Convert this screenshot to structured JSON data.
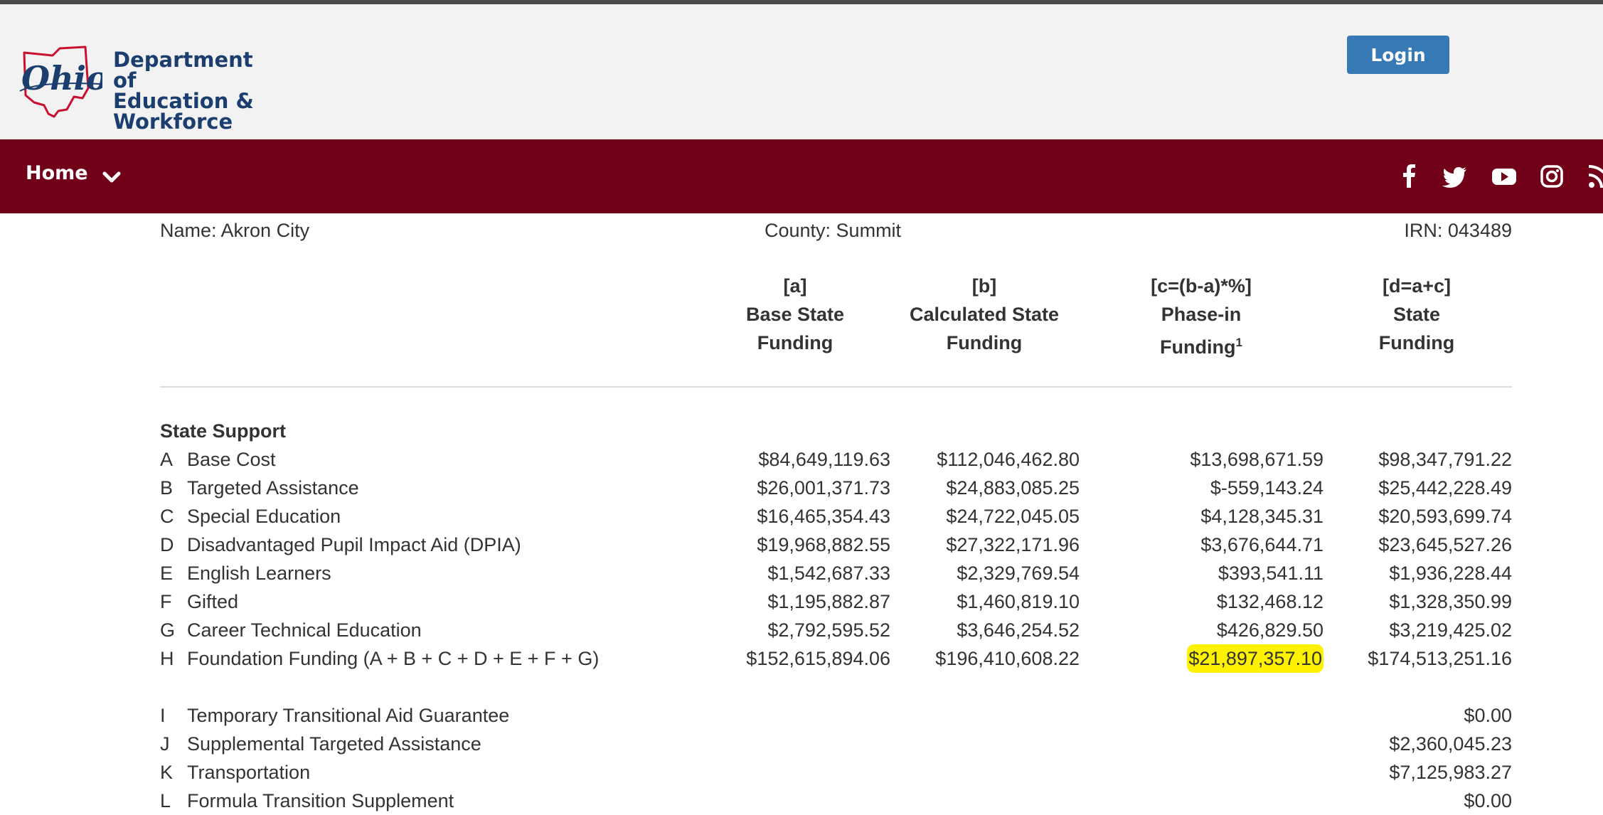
{
  "header": {
    "dept_line1": "Department of",
    "dept_line2": "Education &",
    "dept_line3": "Workforce",
    "login_label": "Login"
  },
  "nav": {
    "home_label": "Home",
    "social_icons": [
      "facebook-icon",
      "twitter-icon",
      "youtube-icon",
      "instagram-icon",
      "rss-icon"
    ]
  },
  "district": {
    "name": "Name: Akron City",
    "county": "County: Summit",
    "irn": "IRN: 043489"
  },
  "columns": [
    {
      "tag": "[a]",
      "line1": "Base State",
      "line2": "Funding",
      "sup": ""
    },
    {
      "tag": "[b]",
      "line1": "Calculated State",
      "line2": "Funding",
      "sup": ""
    },
    {
      "tag": "[c=(b-a)*%]",
      "line1": "Phase-in",
      "line2": "Funding",
      "sup": "1"
    },
    {
      "tag": "[d=a+c]",
      "line1": "State",
      "line2": "Funding",
      "sup": ""
    }
  ],
  "section_title": "State Support",
  "rows": [
    {
      "letter": "A",
      "label": "Base Cost",
      "a": "$84,649,119.63",
      "b": "$112,046,462.80",
      "c": "$13,698,671.59",
      "d": "$98,347,791.22"
    },
    {
      "letter": "B",
      "label": "Targeted Assistance",
      "a": "$26,001,371.73",
      "b": "$24,883,085.25",
      "c": "$-559,143.24",
      "d": "$25,442,228.49"
    },
    {
      "letter": "C",
      "label": "Special Education",
      "a": "$16,465,354.43",
      "b": "$24,722,045.05",
      "c": "$4,128,345.31",
      "d": "$20,593,699.74"
    },
    {
      "letter": "D",
      "label": "Disadvantaged Pupil Impact Aid (DPIA)",
      "a": "$19,968,882.55",
      "b": "$27,322,171.96",
      "c": "$3,676,644.71",
      "d": "$23,645,527.26"
    },
    {
      "letter": "E",
      "label": "English Learners",
      "a": "$1,542,687.33",
      "b": "$2,329,769.54",
      "c": "$393,541.11",
      "d": "$1,936,228.44"
    },
    {
      "letter": "F",
      "label": "Gifted",
      "a": "$1,195,882.87",
      "b": "$1,460,819.10",
      "c": "$132,468.12",
      "d": "$1,328,350.99"
    },
    {
      "letter": "G",
      "label": "Career Technical Education",
      "a": "$2,792,595.52",
      "b": "$3,646,254.52",
      "c": "$426,829.50",
      "d": "$3,219,425.02"
    },
    {
      "letter": "H",
      "label": "Foundation Funding (A + B + C + D + E + F + G)",
      "a": "$152,615,894.06",
      "b": "$196,410,608.22",
      "c": "$21,897,357.10",
      "d": "$174,513,251.16"
    }
  ],
  "other_rows": [
    {
      "letter": "I",
      "label": "Temporary Transitional Aid Guarantee",
      "d": "$0.00"
    },
    {
      "letter": "J",
      "label": "Supplemental Targeted Assistance",
      "d": "$2,360,045.23"
    },
    {
      "letter": "K",
      "label": "Transportation",
      "d": "$7,125,983.27"
    },
    {
      "letter": "L",
      "label": "Formula Transition Supplement",
      "d": "$0.00"
    }
  ],
  "colors": {
    "nav_bg": "#710019",
    "login_bg": "#3779b4",
    "brand_blue": "#1b3e6f",
    "ohio_red": "#c8102e",
    "highlight": "#fff200"
  }
}
